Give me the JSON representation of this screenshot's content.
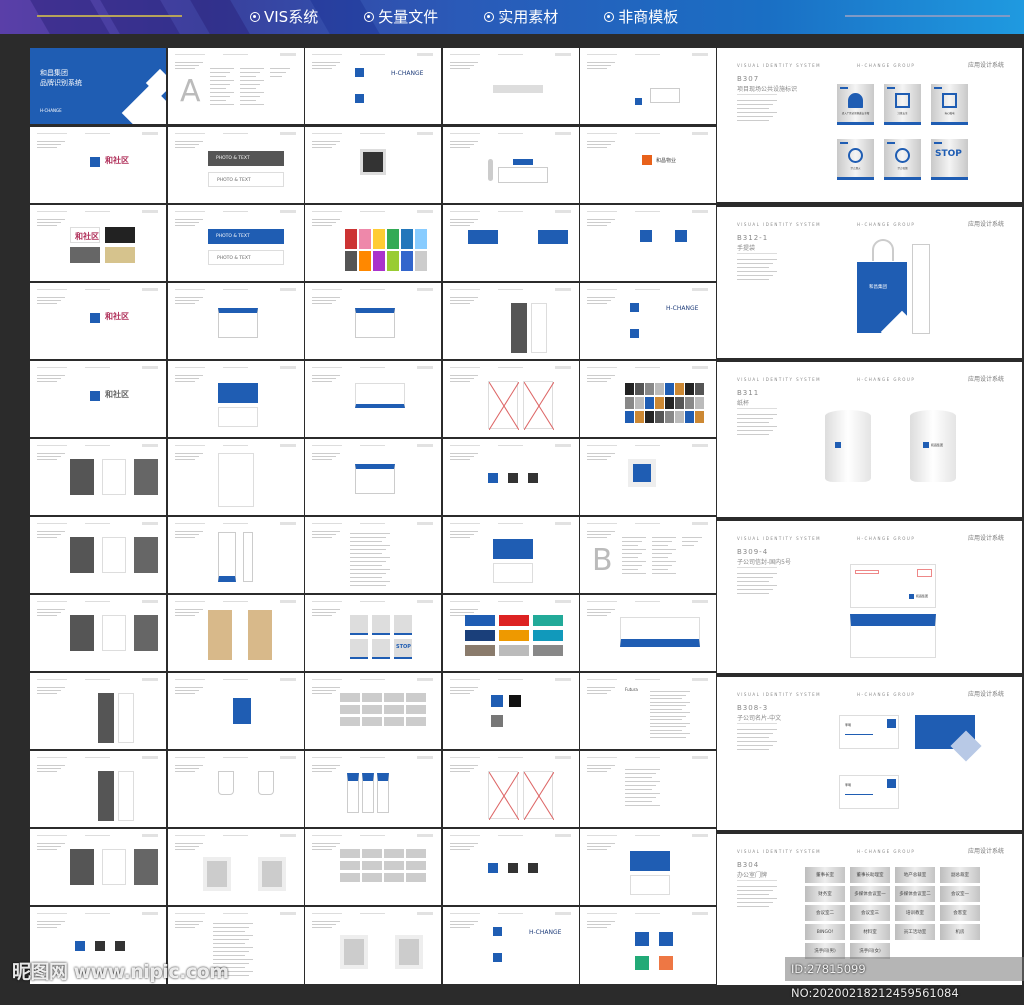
{
  "banner": {
    "tabs": [
      {
        "label": "VIS系统",
        "icon": "radio-dot-icon"
      },
      {
        "label": "矢量文件",
        "icon": "radio-dot-icon"
      },
      {
        "label": "实用素材",
        "icon": "radio-dot-icon"
      },
      {
        "label": "非商模板",
        "icon": "radio-dot-icon"
      }
    ]
  },
  "colors": {
    "brand_blue": "#1f5db3",
    "pink": "#b0305a",
    "dark_grey": "#555555",
    "orange": "#e8611a"
  },
  "cover": {
    "line1": "和昌集团",
    "line2": "品牌识别系统",
    "logo": "H-CHANGE"
  },
  "thumbnails": [
    {
      "kind": "cover"
    },
    {
      "kind": "index",
      "text": "A"
    },
    {
      "kind": "logo",
      "text": "H-CHANGE"
    },
    {
      "kind": "bar"
    },
    {
      "kind": "logosmall"
    },
    {
      "kind": "pink",
      "text": "和社区"
    },
    {
      "kind": "photo",
      "text": "PHOTO & TEXT"
    },
    {
      "kind": "grid4"
    },
    {
      "kind": "reception"
    },
    {
      "kind": "orange",
      "text": "和昌物业"
    },
    {
      "kind": "pinkbg",
      "text": "和社区"
    },
    {
      "kind": "photoblue",
      "text": "PHOTO & TEXT"
    },
    {
      "kind": "swatches"
    },
    {
      "kind": "flags"
    },
    {
      "kind": "logovert"
    },
    {
      "kind": "pink",
      "text": "和社区"
    },
    {
      "kind": "envelope"
    },
    {
      "kind": "envelope"
    },
    {
      "kind": "greytall"
    },
    {
      "kind": "hchange",
      "text": "H-CHANGE"
    },
    {
      "kind": "greytext",
      "text": "和社区"
    },
    {
      "kind": "bluecard"
    },
    {
      "kind": "cards"
    },
    {
      "kind": "xbox"
    },
    {
      "kind": "colorgrid"
    },
    {
      "kind": "greycards"
    },
    {
      "kind": "blank"
    },
    {
      "kind": "envelope"
    },
    {
      "kind": "logosrow"
    },
    {
      "kind": "logobox"
    },
    {
      "kind": "greycards"
    },
    {
      "kind": "folder"
    },
    {
      "kind": "text"
    },
    {
      "kind": "bluecard"
    },
    {
      "kind": "index",
      "text": "B"
    },
    {
      "kind": "greycards"
    },
    {
      "kind": "kraft"
    },
    {
      "kind": "signs",
      "text": "STOP"
    },
    {
      "kind": "palette"
    },
    {
      "kind": "wave"
    },
    {
      "kind": "greytall"
    },
    {
      "kind": "bag"
    },
    {
      "kind": "plates"
    },
    {
      "kind": "logosblack"
    },
    {
      "kind": "fonts",
      "text": "Futura"
    },
    {
      "kind": "greytall"
    },
    {
      "kind": "cups"
    },
    {
      "kind": "hangers"
    },
    {
      "kind": "xbox"
    },
    {
      "kind": "fontlist"
    },
    {
      "kind": "greycards"
    },
    {
      "kind": "frames"
    },
    {
      "kind": "plates"
    },
    {
      "kind": "logosrow"
    },
    {
      "kind": "bluecard"
    },
    {
      "kind": "logosrow"
    },
    {
      "kind": "text"
    },
    {
      "kind": "frames"
    },
    {
      "kind": "hchange",
      "text": "H-CHANGE"
    },
    {
      "kind": "icons"
    }
  ],
  "panels": {
    "header_left": "VISUAL IDENTITY SYSTEM",
    "header_mid": "H-CHANGE GROUP",
    "header_right": "应用设计系统",
    "items": [
      {
        "kind": "signs",
        "code": "B307",
        "title": "项目现场公共设施标识",
        "signs": [
          "进入厂区必须佩戴安全帽",
          "注意安全",
          "当心触电",
          "禁止烟火",
          "禁止吸烟",
          "STOP"
        ]
      },
      {
        "kind": "bag",
        "code": "B312-1",
        "title": "手提袋",
        "logo": "和昌集团"
      },
      {
        "kind": "cups",
        "code": "B311",
        "title": "纸杯",
        "logo": "和昌集团"
      },
      {
        "kind": "envelope",
        "code": "B309-4",
        "title": "子公司信封-国内5号",
        "logo": "和昌集团"
      },
      {
        "kind": "cards",
        "code": "B308-3",
        "title": "子公司名片-中文",
        "name": "李明"
      },
      {
        "kind": "plates",
        "code": "B304",
        "title": "办公室门牌",
        "plates": [
          "董事长室",
          "董事长助理室",
          "地产总裁室",
          "副总裁室",
          "财务室",
          "多媒体会议室一",
          "多媒体会议室二",
          "会议室一",
          "会议室二",
          "会议室三",
          "培训教室",
          "会客室",
          "BINGO!",
          "材料室",
          "员工活动室",
          "机房",
          "洗手间(男)",
          "洗手间(女)"
        ]
      }
    ]
  },
  "watermarks": {
    "site": "昵图网 www.nipic.com",
    "id": "ID:27815099 NO:20200218212459561084"
  }
}
